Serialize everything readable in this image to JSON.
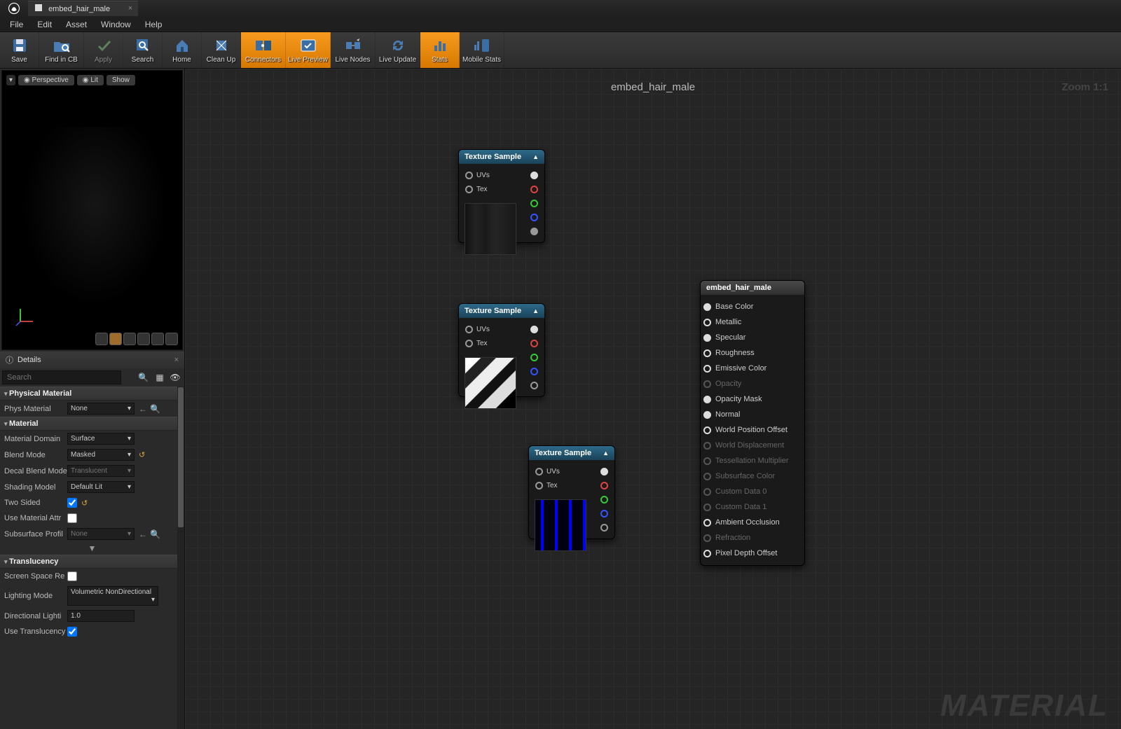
{
  "tab_title": "embed_hair_male",
  "menu": [
    "File",
    "Edit",
    "Asset",
    "Window",
    "Help"
  ],
  "toolbar": [
    {
      "label": "Save",
      "active": false
    },
    {
      "label": "Find in CB",
      "active": false
    },
    {
      "label": "Apply",
      "active": false
    },
    {
      "label": "Search",
      "active": false
    },
    {
      "label": "Home",
      "active": false
    },
    {
      "label": "Clean Up",
      "active": false
    },
    {
      "label": "Connectors",
      "active": true
    },
    {
      "label": "Live Preview",
      "active": true
    },
    {
      "label": "Live Nodes",
      "active": false
    },
    {
      "label": "Live Update",
      "active": false
    },
    {
      "label": "Stats",
      "active": true
    },
    {
      "label": "Mobile Stats",
      "active": false
    }
  ],
  "viewport": {
    "perspective": "Perspective",
    "lit": "Lit",
    "show": "Show"
  },
  "details": {
    "title": "Details",
    "search_placeholder": "Search",
    "cats": {
      "phys": "Physical Material",
      "mat": "Material",
      "trans": "Translucency"
    },
    "phys_material": {
      "label": "Phys Material",
      "value": "None"
    },
    "material_domain": {
      "label": "Material Domain",
      "value": "Surface"
    },
    "blend_mode": {
      "label": "Blend Mode",
      "value": "Masked"
    },
    "decal_blend": {
      "label": "Decal Blend Mode",
      "value": "Translucent"
    },
    "shading_model": {
      "label": "Shading Model",
      "value": "Default Lit"
    },
    "two_sided": {
      "label": "Two Sided",
      "value": true
    },
    "use_mat_attr": {
      "label": "Use Material Attr",
      "value": false
    },
    "subsurface": {
      "label": "Subsurface Profil",
      "value": "None"
    },
    "screen_space": {
      "label": "Screen Space Re",
      "value": false
    },
    "lighting_mode": {
      "label": "Lighting Mode",
      "value": "Volumetric NonDirectional"
    },
    "directional": {
      "label": "Directional Lighti",
      "value": "1.0"
    },
    "use_trans": {
      "label": "Use Translucency",
      "value": true
    }
  },
  "graph": {
    "title": "embed_hair_male",
    "zoom": "Zoom 1:1",
    "watermark": "MATERIAL",
    "tex_sample": "Texture Sample",
    "pins": {
      "uvs": "UVs",
      "tex": "Tex"
    },
    "result": {
      "title": "embed_hair_male",
      "pins": [
        {
          "label": "Base Color",
          "dis": false,
          "hollow": false
        },
        {
          "label": "Metallic",
          "dis": false,
          "hollow": true
        },
        {
          "label": "Specular",
          "dis": false,
          "hollow": false
        },
        {
          "label": "Roughness",
          "dis": false,
          "hollow": true
        },
        {
          "label": "Emissive Color",
          "dis": false,
          "hollow": true
        },
        {
          "label": "Opacity",
          "dis": true,
          "hollow": true
        },
        {
          "label": "Opacity Mask",
          "dis": false,
          "hollow": false
        },
        {
          "label": "Normal",
          "dis": false,
          "hollow": false
        },
        {
          "label": "World Position Offset",
          "dis": false,
          "hollow": true
        },
        {
          "label": "World Displacement",
          "dis": true,
          "hollow": true
        },
        {
          "label": "Tessellation Multiplier",
          "dis": true,
          "hollow": true
        },
        {
          "label": "Subsurface Color",
          "dis": true,
          "hollow": true
        },
        {
          "label": "Custom Data 0",
          "dis": true,
          "hollow": true
        },
        {
          "label": "Custom Data 1",
          "dis": true,
          "hollow": true
        },
        {
          "label": "Ambient Occlusion",
          "dis": false,
          "hollow": true
        },
        {
          "label": "Refraction",
          "dis": true,
          "hollow": true
        },
        {
          "label": "Pixel Depth Offset",
          "dis": false,
          "hollow": true
        }
      ]
    }
  }
}
